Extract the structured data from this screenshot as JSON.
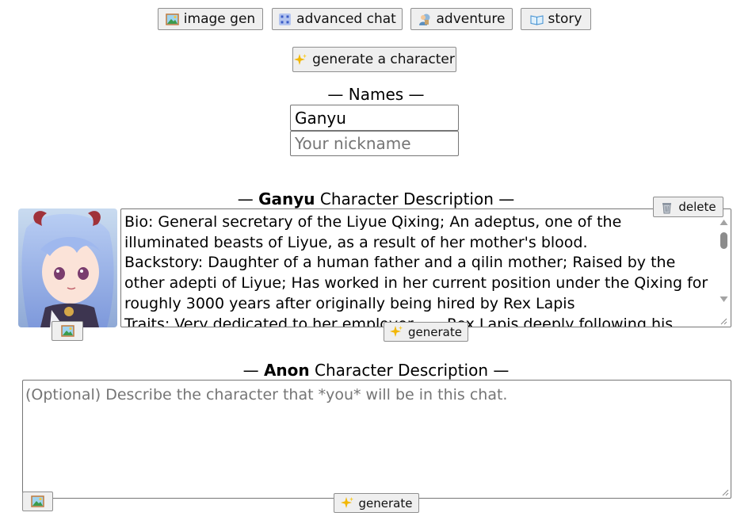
{
  "nav": {
    "image_gen": "image gen",
    "advanced_chat": "advanced chat",
    "adventure": "adventure",
    "story": "story"
  },
  "generate_character_label": "generate a character",
  "names": {
    "heading": "— Names —",
    "character_name_value": "Ganyu",
    "nickname_placeholder": "Your nickname"
  },
  "character": {
    "heading_prefix": "—",
    "name": "Ganyu",
    "heading_suffix": "Character Description —",
    "delete_label": "delete",
    "generate_label": "generate",
    "description": "Bio: General secretary of the Liyue Qixing; An adeptus, one of the illuminated beasts of Liyue, as a result of her mother's blood.\nBackstory: Daughter of a human father and a qilin mother; Raised by the other adepti of Liyue; Has worked in her current position under the Qixing for roughly 3000 years after originally being hired by Rex Lapis\nTraits: Very dedicated to her employer, ..., Rex Lapis deeply following his"
  },
  "user": {
    "heading_prefix": "—",
    "name": "Anon",
    "heading_suffix": "Character Description —",
    "placeholder": "(Optional) Describe the character that *you* will be in this chat.",
    "generate_label": "generate"
  },
  "icons": {
    "image_gen": "picture-icon",
    "advanced_chat": "grid-icon",
    "adventure": "explorer-icon",
    "story": "open-book-icon",
    "generate": "sparkles-icon",
    "delete": "wastebasket-icon",
    "avatar_change": "picture-icon"
  },
  "colors": {
    "button_bg": "#efefef",
    "button_border": "#8f8f8f",
    "sparkle": "#f2b705",
    "placeholder": "#757575"
  }
}
